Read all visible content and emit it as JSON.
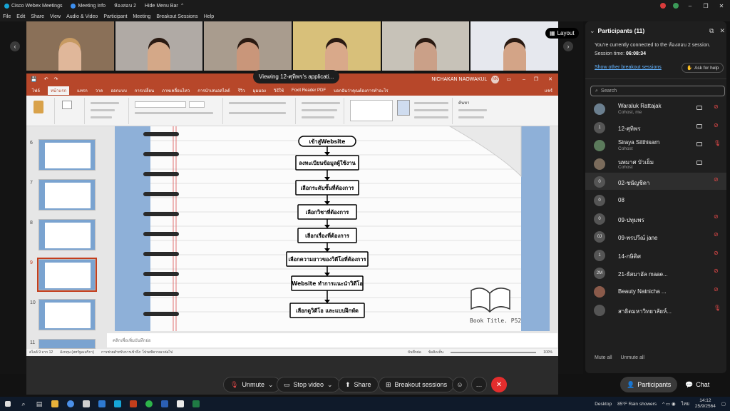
{
  "titlebar": {
    "app_title": "Cisco Webex Meetings",
    "meeting_info": "Meeting Info",
    "room": "ห้องสอบ 2",
    "hide_menu": "Hide Menu Bar"
  },
  "menu": [
    "File",
    "Edit",
    "Share",
    "View",
    "Audio & Video",
    "Participant",
    "Meeting",
    "Breakout Sessions",
    "Help"
  ],
  "stage": {
    "layout_label": "Layout",
    "viewing_label": "Viewing 12-ศุทิพร's applicati...",
    "thumbnail_count": 6
  },
  "ppt": {
    "user": "NICHAKAN NAOWAKUL",
    "user_initials": "NN",
    "ribbon_tabs": [
      "ไฟล์",
      "หน้าแรก",
      "แทรก",
      "วาด",
      "ออกแบบ",
      "การเปลี่ยน",
      "ภาพเคลื่อนไหว",
      "การนำเสนอสไลด์",
      "รีวิว",
      "มุมมอง",
      "วิธีใช้",
      "Foxit Reader PDF"
    ],
    "ribbon_search": "บอกฉันว่าคุณต้องการทำอะไร",
    "ribbon_share": "แชร์",
    "ribbon_search_right": "ค้นหา",
    "notes_placeholder": "คลิกเพื่อเพิ่มบันทึกย่อ",
    "status_slide": "สไลด์ 9 จาก 12",
    "status_lang": "อังกฤษ (สหรัฐอเมริกา)",
    "status_access": "การช่วยสำหรับการเข้าถึง: โปรดพิจารณาต่อไป",
    "status_notes": "บันทึกย่อ",
    "status_comments": "ข้อคิดเห็น",
    "zoom": "100%",
    "slide_numbers": [
      "6",
      "7",
      "8",
      "9",
      "10",
      "11"
    ]
  },
  "slide": {
    "steps": [
      "เข้าสู่Website",
      "ลงทะเบียนข้อมูลผู้ใช้งาน",
      "เลือกระดับชั้นที่ต้องการ",
      "เลือกวิชาที่ต้องการ",
      "เลือกเรื่องที่ต้องการ",
      "เลือกความยาวของวิดีโอที่ต้องการ",
      "Website ทำการแนะนำวิดีโอ",
      "เลือกดูวิดีโอ และแบบฝึกหัด"
    ],
    "book_label": "Book Title. P52"
  },
  "controls": {
    "unmute": "Unmute",
    "stop_video": "Stop video",
    "share": "Share",
    "breakout": "Breakout sessions"
  },
  "panel": {
    "title": "Participants (11)",
    "info_line1": "You're currently connected to the ห้องสอบ 2 session.",
    "session_time_label": "Session time:",
    "session_time": "06:08:34",
    "show_other": "Show other breakout sessions",
    "ask_help": "Ask for help",
    "search_placeholder": "Search",
    "participants": [
      {
        "name": "Waraluk Rattajak",
        "sub": "Cohost, me",
        "initials": "",
        "mic": "muted"
      },
      {
        "name": "12-ศุทิพร",
        "sub": "",
        "initials": "1",
        "mic": "muted"
      },
      {
        "name": "Siraya Sitthisarn",
        "sub": "Cohost",
        "initials": "",
        "mic": "live"
      },
      {
        "name": "นพมาศ บัวเย็ม",
        "sub": "Cohost",
        "initials": "",
        "mic": "none"
      },
      {
        "name": "02-ชนัญชิดา",
        "sub": "",
        "initials": "0",
        "mic": "muted"
      },
      {
        "name": "08",
        "sub": "",
        "initials": "0",
        "mic": "none"
      },
      {
        "name": "09-ปทุมพร",
        "sub": "",
        "initials": "0",
        "mic": "muted"
      },
      {
        "name": "09-พรปวีณ์ jane",
        "sub": "",
        "initials": "0J",
        "mic": "muted"
      },
      {
        "name": "14-กษิติศ",
        "sub": "",
        "initials": "1",
        "mic": "muted"
      },
      {
        "name": "21-ธัสมาอัล maae...",
        "sub": "",
        "initials": "2M",
        "mic": "muted"
      },
      {
        "name": "Beauty Natnicha ...",
        "sub": "",
        "initials": "",
        "mic": "muted"
      },
      {
        "name": "สาธิตมหาวิทยาลัยห์...",
        "sub": "",
        "initials": "",
        "mic": "live"
      }
    ],
    "mute_all": "Mute all",
    "unmute_all": "Unmute all",
    "tab_participants": "Participants",
    "tab_chat": "Chat"
  },
  "taskbar": {
    "desktop": "Desktop",
    "weather": "85°F  Rain showers",
    "lang": "ไทย",
    "time": "14:12",
    "date": "25/9/2564"
  }
}
